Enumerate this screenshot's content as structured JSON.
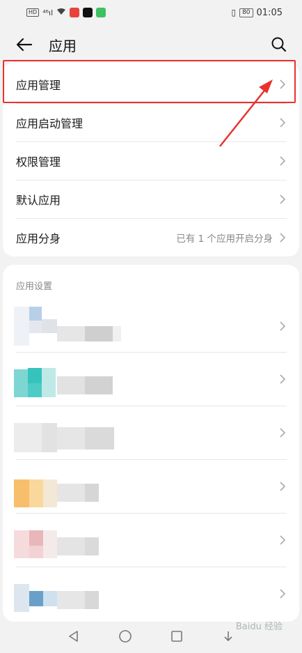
{
  "status_bar": {
    "network_chip": "HD",
    "signal": "⁴⁶ıl",
    "battery": "80",
    "time": "01:05"
  },
  "header": {
    "title": "应用",
    "back_icon": "arrow-left-icon",
    "search_icon": "search-icon"
  },
  "menu": {
    "items": [
      {
        "label": "应用管理",
        "value": ""
      },
      {
        "label": "应用启动管理",
        "value": ""
      },
      {
        "label": "权限管理",
        "value": ""
      },
      {
        "label": "默认应用",
        "value": ""
      },
      {
        "label": "应用分身",
        "value": "已有 1 个应用开启分身"
      }
    ]
  },
  "app_settings": {
    "section_label": "应用设置",
    "app_count_visible": 6
  },
  "colors": {
    "highlight": "#e8322f",
    "background": "#f2f2f2",
    "card": "#ffffff"
  },
  "watermark": "Baidu 经验"
}
